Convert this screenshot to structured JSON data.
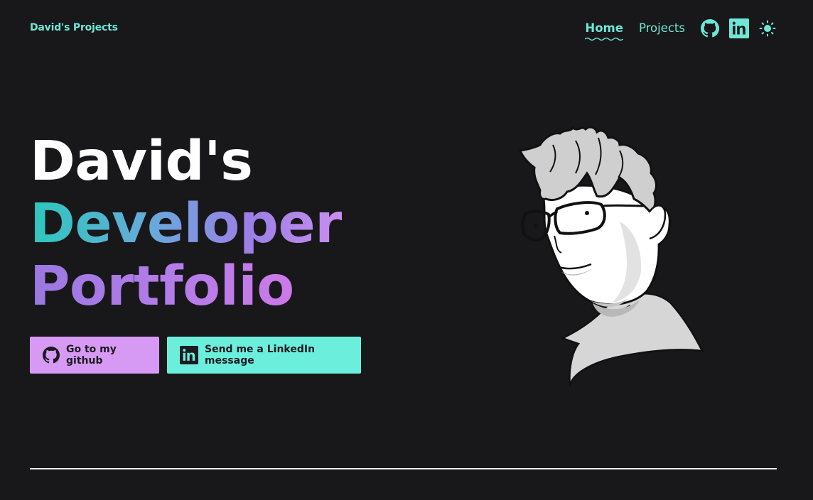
{
  "brand": {
    "label": "David's Projects"
  },
  "nav": {
    "items": [
      {
        "label": "Home",
        "active": true
      },
      {
        "label": "Projects",
        "active": false
      }
    ],
    "icons": [
      "github-icon",
      "linkedin-icon",
      "sun-icon"
    ]
  },
  "hero": {
    "line1": "David's",
    "line2": "Developer",
    "line3": "Portfolio"
  },
  "buttons": {
    "github_label": "Go to my github",
    "linkedin_label": "Send me a LinkedIn message"
  },
  "colors": {
    "background": "#18171a",
    "accent_teal": "#6ee7d6",
    "accent_purple": "#d79af4",
    "button_teal": "#6ceedd"
  }
}
